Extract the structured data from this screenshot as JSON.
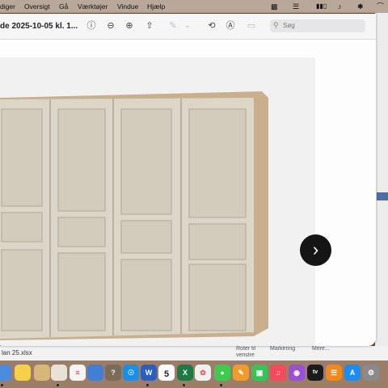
{
  "menubar": {
    "items": [
      "diger",
      "Oversigt",
      "Gå",
      "Værktøjer",
      "Vindue",
      "Hjælp"
    ],
    "status_icons": [
      "screen-mirror-icon",
      "battery-icon",
      "volume-icon",
      "wifi-icon"
    ]
  },
  "window": {
    "title": "de 2025-10-05 kl. 1...",
    "toolbar_icons": [
      "info-icon",
      "zoom-out-icon",
      "zoom-in-icon",
      "share-icon",
      "markup-pen-icon",
      "rotate-icon",
      "markup-icon",
      "annotate-icon"
    ],
    "search_placeholder": "Søg",
    "image_subject": "wardrobe-doors-3d-render"
  },
  "background": {
    "file_label": "lan 25.xlsx",
    "actions": [
      "Roter til venstre",
      "Markering",
      "Mere..."
    ]
  },
  "dock": {
    "apps": [
      "chrome",
      "notes",
      "finder",
      "photos",
      "reminders",
      "keynote",
      "calendar",
      "help",
      "safari",
      "word",
      "calendar-date",
      "excel",
      "photos-app",
      "messages",
      "pages",
      "facetime",
      "music",
      "podcasts",
      "apple-tv",
      "books",
      "app-store",
      "system-settings"
    ],
    "calendar_day": "5",
    "calendar_month": "OKT"
  },
  "colors": {
    "panel": "#dcd6c8",
    "panel_inner": "#cfc8b8",
    "wood_edge": "#c8b08e",
    "next_button": "#151515"
  }
}
